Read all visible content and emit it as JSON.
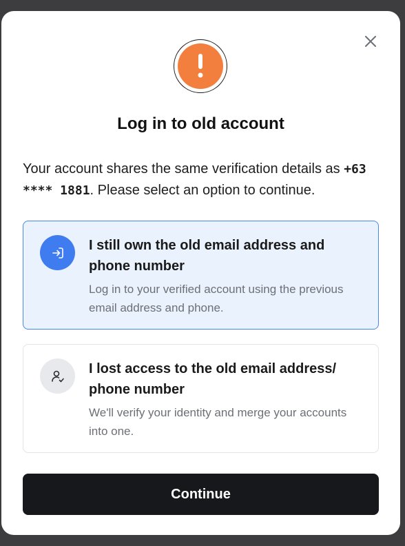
{
  "dialog": {
    "title": "Log in to old account",
    "description_prefix": "Your account shares the same verification details as ",
    "phone": "+63 **** 1881",
    "description_suffix": ". Please select an option to continue.",
    "close_icon": "close-icon",
    "alert_icon": "exclamation-icon"
  },
  "options": [
    {
      "title": "I still own the old email address and phone number",
      "subtitle": "Log in to your verified account using the previous email address and phone.",
      "icon": "login-arrow-icon",
      "selected": true
    },
    {
      "title": "I lost access to the old email address/ phone number",
      "subtitle": "We'll verify your identity and merge your accounts into one.",
      "icon": "user-check-icon",
      "selected": false
    }
  ],
  "actions": {
    "continue_label": "Continue"
  },
  "colors": {
    "accent_orange": "#f27f3d",
    "accent_blue": "#3e7cf0",
    "selected_bg": "#eaf2fe",
    "button_dark": "#17181b"
  }
}
